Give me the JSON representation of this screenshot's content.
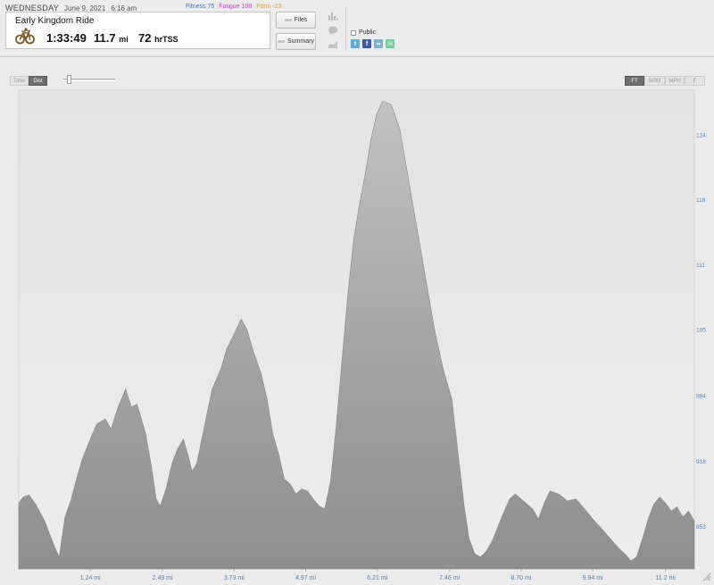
{
  "activity": {
    "weekday": "WEDNESDAY",
    "date": "June 9, 2021",
    "time": "6:16 am",
    "title": "Early Kingdom Ride",
    "duration": "1:33:49",
    "distance": "11.7",
    "distance_unit": "mi",
    "tss": "72",
    "tss_unit": "hrTSS",
    "icon": "bike-icon"
  },
  "metrics": {
    "fitness_label": "Fitness 75",
    "fatigue_label": "Fatigue 108",
    "form_label": "Form -23",
    "colors": {
      "fitness": "#3c78c8",
      "fatigue": "#d63cc8",
      "form": "#e8a020"
    }
  },
  "buttons": {
    "files": "Files",
    "summary": "Summary"
  },
  "side_icons": [
    "bar-chart-icon",
    "comment-icon",
    "analysis-icon"
  ],
  "sharing": {
    "public_label": "Public",
    "icons": [
      "twitter-icon",
      "facebook-icon",
      "link-icon",
      "email-icon"
    ],
    "colors": {
      "twitter": "#5aaee0",
      "facebook": "#3b5b9a",
      "link": "#7fb0c8",
      "email": "#6fcf9a"
    }
  },
  "axis_toggle": {
    "time": "Time",
    "dist": "Dist",
    "selected": "Dist"
  },
  "unit_toggle": {
    "ft": "FT",
    "bpm": "BPM",
    "mph": "MPH",
    "f": "F",
    "selected": "FT"
  },
  "chart_data": {
    "type": "area",
    "xlabel": "",
    "ylabel": "",
    "x_unit": "mi",
    "x_ticks": [
      "1.24 mi",
      "2.49 mi",
      "3.73 mi",
      "4.97 mi",
      "6.21 mi",
      "7.46 mi",
      "8.70 mi",
      "9.94 mi",
      "11.2 mi"
    ],
    "x_tick_values": [
      1.24,
      2.49,
      3.73,
      4.97,
      6.21,
      7.46,
      8.7,
      9.94,
      11.2
    ],
    "y_ticks": [
      "124",
      "118",
      "111",
      "105",
      "984",
      "918",
      "853"
    ],
    "y_tick_values": [
      1245,
      1180,
      1115,
      1050,
      984,
      918,
      853
    ],
    "xlim": [
      0,
      11.7
    ],
    "ylim": [
      810,
      1290
    ],
    "series": [
      {
        "color": "#9e9e9e",
        "x": [
          0,
          0.08,
          0.18,
          0.3,
          0.45,
          0.6,
          0.7,
          0.8,
          0.9,
          1.0,
          1.1,
          1.24,
          1.35,
          1.5,
          1.6,
          1.72,
          1.85,
          1.95,
          2.05,
          2.2,
          2.3,
          2.38,
          2.45,
          2.55,
          2.65,
          2.75,
          2.85,
          2.95,
          3.0,
          3.08,
          3.2,
          3.35,
          3.5,
          3.6,
          3.73,
          3.85,
          3.95,
          4.05,
          4.2,
          4.3,
          4.4,
          4.5,
          4.6,
          4.7,
          4.8,
          4.9,
          5.0,
          5.1,
          5.2,
          5.3,
          5.4,
          5.5,
          5.6,
          5.7,
          5.8,
          5.9,
          6.0,
          6.1,
          6.2,
          6.3,
          6.45,
          6.6,
          6.75,
          6.9,
          7.05,
          7.2,
          7.35,
          7.5,
          7.62,
          7.72,
          7.8,
          7.9,
          8.0,
          8.1,
          8.2,
          8.35,
          8.5,
          8.6,
          8.7,
          8.8,
          8.9,
          9.0,
          9.1,
          9.2,
          9.35,
          9.5,
          9.65,
          9.8,
          9.94,
          10.1,
          10.25,
          10.4,
          10.5,
          10.6,
          10.7,
          10.8,
          10.9,
          11.0,
          11.1,
          11.2,
          11.3,
          11.4,
          11.5,
          11.6,
          11.7
        ],
        "values": [
          876,
          882,
          884,
          874,
          858,
          835,
          822,
          862,
          878,
          900,
          920,
          940,
          955,
          960,
          950,
          972,
          990,
          972,
          975,
          945,
          912,
          880,
          873,
          890,
          915,
          930,
          940,
          920,
          908,
          915,
          948,
          990,
          1010,
          1030,
          1045,
          1060,
          1050,
          1030,
          1005,
          980,
          945,
          925,
          900,
          895,
          885,
          890,
          888,
          880,
          873,
          870,
          898,
          955,
          1020,
          1085,
          1140,
          1175,
          1205,
          1240,
          1265,
          1278,
          1275,
          1250,
          1200,
          1150,
          1100,
          1050,
          1010,
          980,
          920,
          870,
          840,
          825,
          822,
          828,
          838,
          860,
          880,
          885,
          880,
          875,
          870,
          860,
          876,
          888,
          885,
          878,
          880,
          870,
          860,
          850,
          840,
          830,
          825,
          818,
          822,
          840,
          860,
          875,
          882,
          876,
          868,
          872,
          862,
          868,
          858
        ]
      }
    ]
  }
}
